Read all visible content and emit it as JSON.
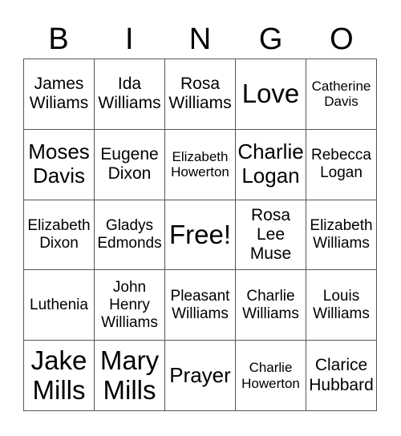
{
  "header": {
    "letters": [
      "B",
      "I",
      "N",
      "G",
      "O"
    ]
  },
  "card": {
    "rows": [
      [
        "James\nWiliams",
        "Ida\nWilliams",
        "Rosa\nWilliams",
        "Love",
        "Catherine\nDavis"
      ],
      [
        "Moses\nDavis",
        "Eugene\nDixon",
        "Elizabeth\nHowerton",
        "Charlie\nLogan",
        "Rebecca\nLogan"
      ],
      [
        "Elizabeth\nDixon",
        "Gladys\nEdmonds",
        "Free!",
        "Rosa\nLee\nMuse",
        "Elizabeth\nWilliams"
      ],
      [
        "Luthenia",
        "John\nHenry\nWilliams",
        "Pleasant\nWilliams",
        "Charlie\nWilliams",
        "Louis\nWilliams"
      ],
      [
        "Jake\nMills",
        "Mary\nMills",
        "Prayer",
        "Charlie\nHowerton",
        "Clarice\nHubbard"
      ]
    ]
  }
}
